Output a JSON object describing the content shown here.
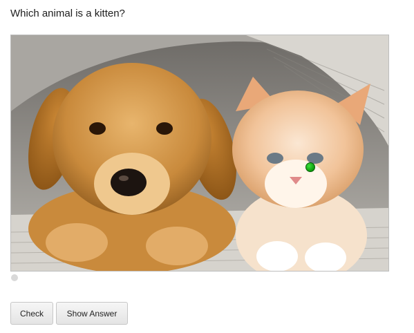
{
  "question": {
    "text": "Which animal is a kitten?"
  },
  "hotspot_image": {
    "subject": "puppy and kitten under a newspaper",
    "marker_color": "#1aa81a"
  },
  "pager": {
    "dots": 1
  },
  "buttons": {
    "check_label": "Check",
    "show_answer_label": "Show Answer"
  }
}
